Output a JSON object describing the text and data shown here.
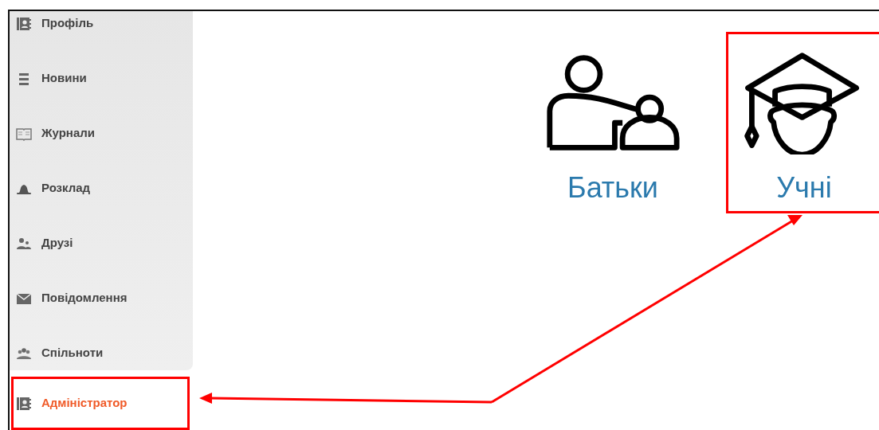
{
  "sidebar": {
    "items": [
      {
        "label": "Профіль",
        "kind": "contact-book",
        "selected": false,
        "highlighted": false
      },
      {
        "label": "Новини",
        "kind": "bars",
        "selected": false,
        "highlighted": false
      },
      {
        "label": "Журнали",
        "kind": "book",
        "selected": false,
        "highlighted": false
      },
      {
        "label": "Розклад",
        "kind": "bell",
        "selected": false,
        "highlighted": false
      },
      {
        "label": "Друзі",
        "kind": "people",
        "selected": false,
        "highlighted": false
      },
      {
        "label": "Повідомлення",
        "kind": "envelope",
        "selected": false,
        "highlighted": false
      },
      {
        "label": "Спільноти",
        "kind": "group",
        "selected": false,
        "highlighted": false
      },
      {
        "label": "Адміністратор",
        "kind": "contact-book",
        "selected": true,
        "highlighted": true
      }
    ]
  },
  "tiles": [
    {
      "label": "Батьки",
      "kind": "parent",
      "highlighted": false
    },
    {
      "label": "Учні",
      "kind": "student",
      "highlighted": true
    }
  ]
}
